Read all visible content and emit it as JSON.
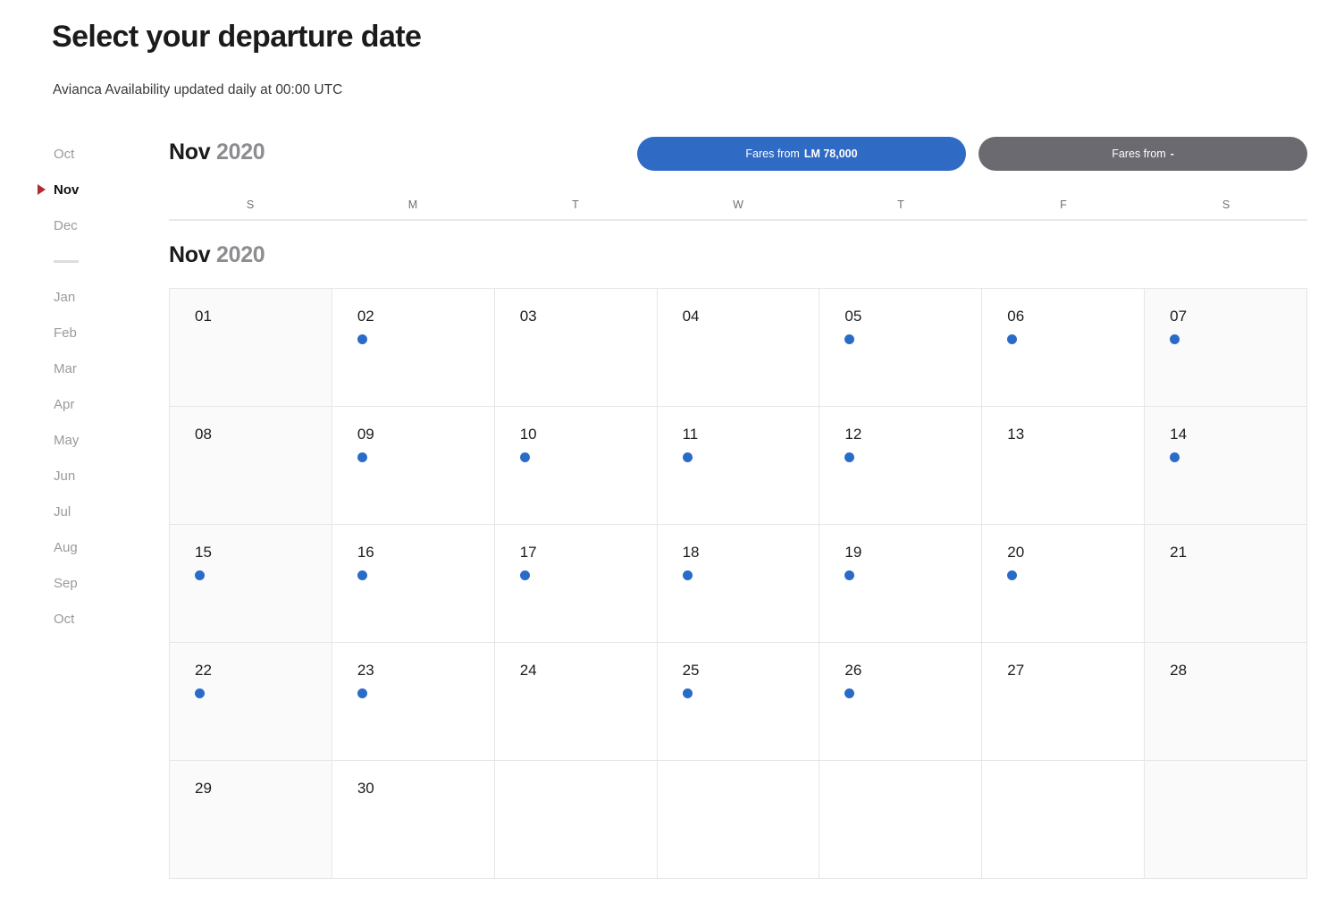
{
  "header": {
    "title": "Select your departure date",
    "subtitle": "Avianca Availability updated daily at 00:00 UTC"
  },
  "sidebar": {
    "items": [
      {
        "label": "Oct",
        "active": false,
        "divider": false
      },
      {
        "label": "Nov",
        "active": true,
        "divider": false
      },
      {
        "label": "Dec",
        "active": false,
        "divider": false
      },
      {
        "label": "",
        "active": false,
        "divider": true
      },
      {
        "label": "Jan",
        "active": false,
        "divider": false
      },
      {
        "label": "Feb",
        "active": false,
        "divider": false
      },
      {
        "label": "Mar",
        "active": false,
        "divider": false
      },
      {
        "label": "Apr",
        "active": false,
        "divider": false
      },
      {
        "label": "May",
        "active": false,
        "divider": false
      },
      {
        "label": "Jun",
        "active": false,
        "divider": false
      },
      {
        "label": "Jul",
        "active": false,
        "divider": false
      },
      {
        "label": "Aug",
        "active": false,
        "divider": false
      },
      {
        "label": "Sep",
        "active": false,
        "divider": false
      },
      {
        "label": "Oct",
        "active": false,
        "divider": false
      }
    ]
  },
  "calendar": {
    "month_label": "Nov",
    "year_label": "2020",
    "sub_month_label": "Nov",
    "sub_year_label": "2020",
    "weekdays": [
      "S",
      "M",
      "T",
      "W",
      "T",
      "F",
      "S"
    ],
    "weeks": [
      [
        {
          "day": "01",
          "dot": false,
          "weekend": true
        },
        {
          "day": "02",
          "dot": true,
          "weekend": false
        },
        {
          "day": "03",
          "dot": false,
          "weekend": false
        },
        {
          "day": "04",
          "dot": false,
          "weekend": false
        },
        {
          "day": "05",
          "dot": true,
          "weekend": false
        },
        {
          "day": "06",
          "dot": true,
          "weekend": false
        },
        {
          "day": "07",
          "dot": true,
          "weekend": true
        }
      ],
      [
        {
          "day": "08",
          "dot": false,
          "weekend": true
        },
        {
          "day": "09",
          "dot": true,
          "weekend": false
        },
        {
          "day": "10",
          "dot": true,
          "weekend": false
        },
        {
          "day": "11",
          "dot": true,
          "weekend": false
        },
        {
          "day": "12",
          "dot": true,
          "weekend": false
        },
        {
          "day": "13",
          "dot": false,
          "weekend": false
        },
        {
          "day": "14",
          "dot": true,
          "weekend": true
        }
      ],
      [
        {
          "day": "15",
          "dot": true,
          "weekend": true
        },
        {
          "day": "16",
          "dot": true,
          "weekend": false
        },
        {
          "day": "17",
          "dot": true,
          "weekend": false
        },
        {
          "day": "18",
          "dot": true,
          "weekend": false
        },
        {
          "day": "19",
          "dot": true,
          "weekend": false
        },
        {
          "day": "20",
          "dot": true,
          "weekend": false
        },
        {
          "day": "21",
          "dot": false,
          "weekend": true
        }
      ],
      [
        {
          "day": "22",
          "dot": true,
          "weekend": true
        },
        {
          "day": "23",
          "dot": true,
          "weekend": false
        },
        {
          "day": "24",
          "dot": false,
          "weekend": false
        },
        {
          "day": "25",
          "dot": true,
          "weekend": false
        },
        {
          "day": "26",
          "dot": true,
          "weekend": false
        },
        {
          "day": "27",
          "dot": false,
          "weekend": false
        },
        {
          "day": "28",
          "dot": false,
          "weekend": true
        }
      ],
      [
        {
          "day": "29",
          "dot": false,
          "weekend": true
        },
        {
          "day": "30",
          "dot": false,
          "weekend": false
        },
        {
          "day": "",
          "dot": false,
          "weekend": false
        },
        {
          "day": "",
          "dot": false,
          "weekend": false
        },
        {
          "day": "",
          "dot": false,
          "weekend": false
        },
        {
          "day": "",
          "dot": false,
          "weekend": false
        },
        {
          "day": "",
          "dot": false,
          "weekend": true
        }
      ]
    ]
  },
  "fare_buttons": [
    {
      "label": "Fares from",
      "amount": "LM 78,000",
      "style": "primary"
    },
    {
      "label": "Fares from",
      "amount": "-",
      "style": "secondary"
    }
  ],
  "colors": {
    "primary_blue": "#2f6ac4",
    "dot_blue": "#2a6bc8",
    "secondary_gray": "#6a6a70",
    "marker_red": "#b02a33",
    "weekend_bg": "#fafafa",
    "grid_border": "#e6e6e6"
  }
}
